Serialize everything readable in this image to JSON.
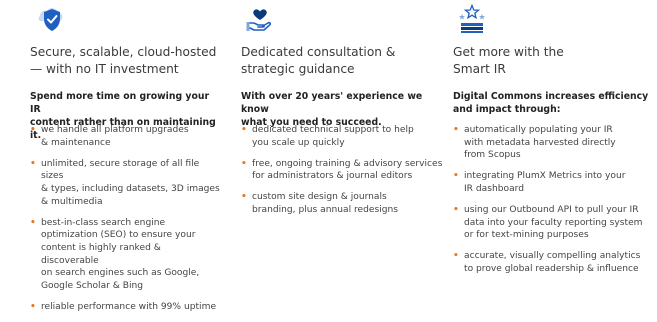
{
  "columns": [
    {
      "icon": "shield-cloud-checkmark-icon",
      "title_lines": [
        "Secure, scalable, cloud-hosted",
        "— with no IT investment"
      ],
      "intro_lines": [
        "Spend more time on growing your IR",
        "content rather than on maintaining it."
      ],
      "items": [
        [
          "we handle all platform upgrades",
          "& maintenance"
        ],
        [
          "unlimited, secure storage of all file sizes",
          "& types, including datasets, 3D images",
          "& multimedia"
        ],
        [
          "best-in-class search engine",
          "optimization (SEO) to ensure your",
          "content is highly ranked & discoverable",
          "on search engines such as Google,",
          "Google Scholar & Bing"
        ],
        [
          "reliable performance with 99% uptime"
        ]
      ]
    },
    {
      "icon": "hand-holding-heart-icon",
      "title_lines": [
        "Dedicated consultation &",
        "strategic guidance"
      ],
      "intro_lines": [
        "With over 20 years' experience we know",
        "what you need to succeed."
      ],
      "items": [
        [
          "dedicated technical support to help",
          "you scale up quickly"
        ],
        [
          "free, ongoing training & advisory services",
          "for administrators & journal editors"
        ],
        [
          "custom site design & journals",
          "branding, plus annual redesigns"
        ]
      ]
    },
    {
      "icon": "star-chart-icon",
      "title_lines": [
        "Get more with the",
        "Smart IR"
      ],
      "intro_lines": [
        "Digital Commons increases efficiency",
        "and impact through:"
      ],
      "items": [
        [
          "automatically populating your IR",
          "with metadata harvested directly",
          "from Scopus"
        ],
        [
          "integrating PlumX Metrics into your",
          "IR dashboard"
        ],
        [
          "using our Outbound API to pull your IR",
          "data into your faculty reporting system",
          "or for text-mining purposes"
        ],
        [
          "accurate, visually compelling analytics",
          "to prove global readership & influence"
        ]
      ]
    }
  ],
  "colors": {
    "icon_blue": "#1f5fbf",
    "icon_navy": "#0b3c7a",
    "bullet_orange": "#e87722"
  }
}
